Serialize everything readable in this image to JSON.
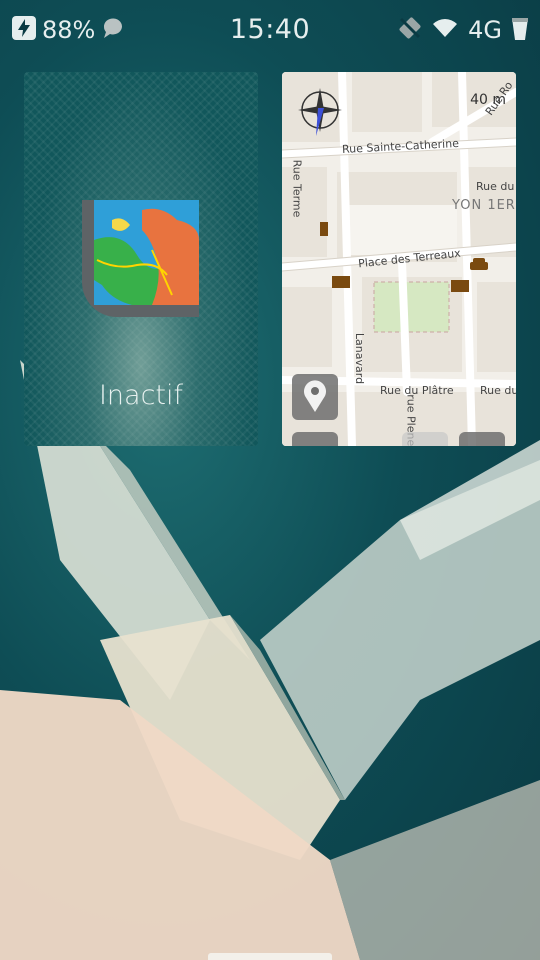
{
  "status_bar": {
    "battery_percent": "88%",
    "time": "15:40",
    "network": "4G",
    "icons": [
      "charging-bolt-icon",
      "notification-bubble-icon",
      "no-sim-icon",
      "wifi-icon",
      "battery-icon"
    ]
  },
  "covers": [
    {
      "app": "map-app",
      "status_label": "Inactif",
      "icon": "world-map-icon"
    },
    {
      "app": "city-map",
      "scale_label": "40 m",
      "map_labels": {
        "rue_sainte_catherine": "Rue Sainte-Catherine",
        "rue_du_top": "Rue du",
        "yon": "YON 1ER",
        "place_des_terreaux": "Place des Terreaux",
        "rue_terme": "Rue Terme",
        "lanavard": "Lanavard",
        "rue_du_platre": "Rue du Plâtre",
        "rue_du_bottom": "Rue du",
        "rue_ro": "Rue Ro",
        "chenay": "rue Pleney"
      },
      "icons": [
        "compass-icon",
        "map-pin-icon",
        "car-icon",
        "bank-icon"
      ]
    }
  ],
  "colors": {
    "wallpaper": "#0e4d55",
    "card_left_bg": "#11575b",
    "map_bg": "#f2efe9",
    "map_road": "#ffffff",
    "map_park": "#d6e8c2"
  }
}
